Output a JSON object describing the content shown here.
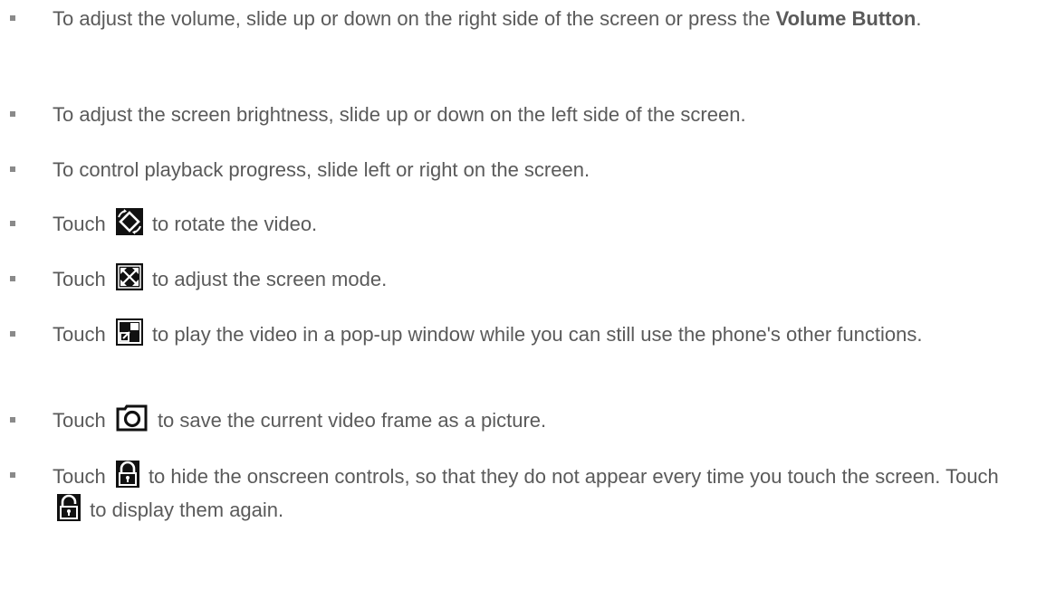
{
  "items": [
    {
      "lead": "To adjust the volume, slide up or down on the right side of the screen or press the ",
      "bold": "Volume Button",
      "tail": "."
    },
    {
      "text": "To adjust the screen brightness, slide up or down on the left side of the screen."
    },
    {
      "text": "To control playback progress, slide left or right on the screen."
    },
    {
      "pre": "Touch",
      "icon": "rotate-icon",
      "post": "to rotate the video."
    },
    {
      "pre": "Touch",
      "icon": "screen-mode-icon",
      "post": "to adjust the screen mode."
    },
    {
      "pre": "Touch",
      "icon": "popup-window-icon",
      "post": "to play the video in a pop-up window while you can still use the phone's other functions."
    },
    {
      "pre": "Touch",
      "icon": "camera-icon",
      "post": "to save the current video frame as a picture."
    },
    {
      "pre": "Touch",
      "icon": "lock-icon",
      "post": "to hide the onscreen controls, so that they do not appear every time you touch the screen.",
      "pre2": "Touch",
      "icon2": "unlock-icon",
      "post2": "to display them again."
    }
  ],
  "colors": {
    "text": "#5a5a5a",
    "bullet": "#8a8a8a",
    "icon_dark": "#111111"
  }
}
